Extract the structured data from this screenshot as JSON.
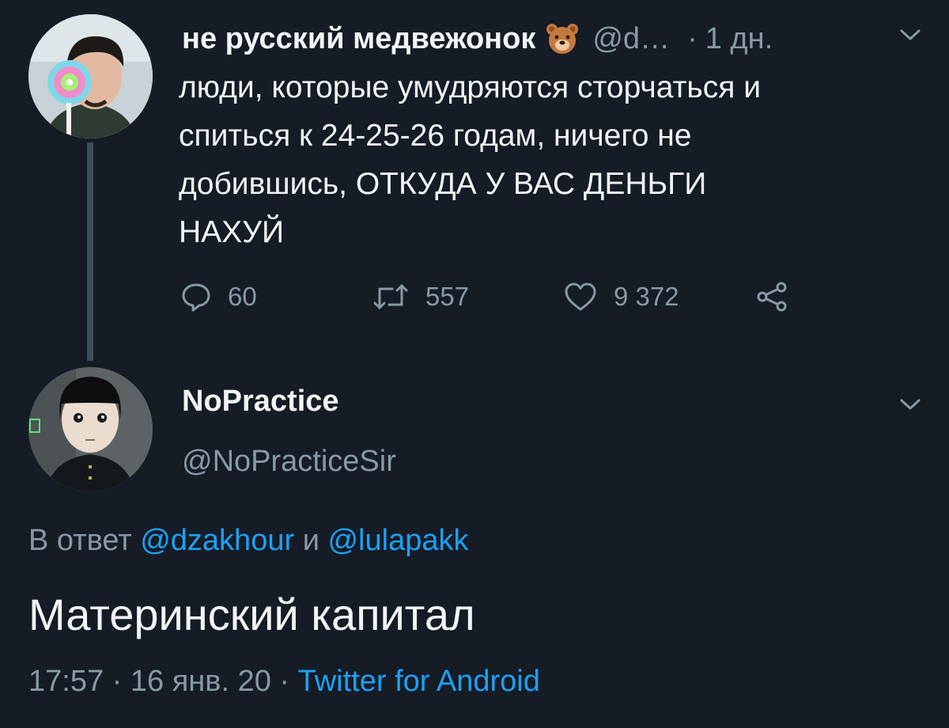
{
  "original_tweet": {
    "author": {
      "display_name": "не русский медвежонок",
      "emoji": "bear-face-emoji",
      "handle_truncated": "@d…",
      "separator": "·",
      "time_ago": "1 дн."
    },
    "text_lines": [
      "люди, которые умудряются сторчаться и",
      "спиться к 24-25-26 годам, ничего не",
      "добившись, ОТКУДА У ВАС ДЕНЬГИ",
      "НАХУЙ"
    ],
    "actions": {
      "reply_count": "60",
      "retweet_count": "557",
      "like_count": "9 372"
    }
  },
  "reply_tweet": {
    "author": {
      "display_name": "NoPractice",
      "handle": "@NoPracticeSir"
    },
    "reply_to": {
      "prefix": "В ответ",
      "mention1": "@dzakhour",
      "conjunction": "и",
      "mention2": "@lulapakk"
    },
    "text": "Материнский капитал",
    "meta": {
      "time": "17:57",
      "separator": "·",
      "date": "16 янв. 20",
      "source": "Twitter for Android"
    }
  },
  "colors": {
    "background": "#151c26",
    "primary_text": "#f2f4f5",
    "secondary_text": "#8899a6",
    "link": "#1da1f2",
    "thread_line": "#3d4d5e"
  }
}
